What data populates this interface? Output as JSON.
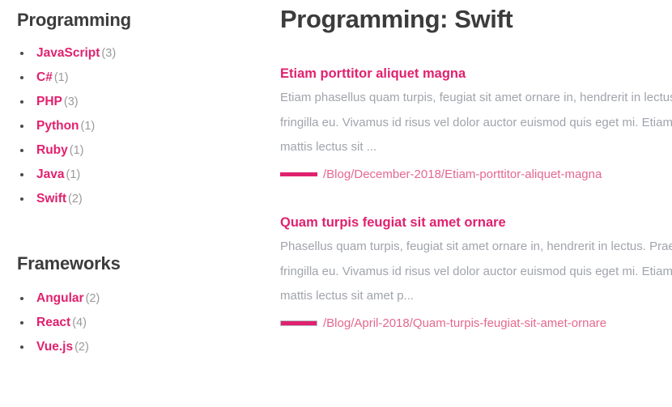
{
  "sidebar": {
    "sections": [
      {
        "heading": "Programming",
        "items": [
          {
            "label": "JavaScript",
            "count": "(3)"
          },
          {
            "label": "C#",
            "count": "(1)"
          },
          {
            "label": "PHP",
            "count": "(3)"
          },
          {
            "label": "Python",
            "count": "(1)"
          },
          {
            "label": "Ruby",
            "count": "(1)"
          },
          {
            "label": "Java",
            "count": "(1)"
          },
          {
            "label": "Swift",
            "count": "(2)"
          }
        ]
      },
      {
        "heading": "Frameworks",
        "items": [
          {
            "label": "Angular",
            "count": "(2)"
          },
          {
            "label": "React",
            "count": "(4)"
          },
          {
            "label": "Vue.js",
            "count": "(2)"
          }
        ]
      }
    ]
  },
  "main": {
    "page_title": "Programming: Swift",
    "posts": [
      {
        "title": "Etiam porttitor aliquet magna",
        "body_lines": [
          "Etiam phasellus quam turpis, feugiat sit amet ornare in, hendrerit in lectus. Praesent semper",
          "fringilla eu. Vivamus id risus vel dolor auctor euismod quis eget mi. Etiam eu ligula consectetur,",
          "mattis lectus sit ..."
        ],
        "url": "/Blog/December-2018/Etiam-porttitor-aliquet-magna"
      },
      {
        "title": "Quam turpis feugiat sit amet ornare",
        "body_lines": [
          "Phasellus quam turpis, feugiat sit amet ornare in, hendrerit in lectus. Praesent semper mollis",
          "fringilla eu. Vivamus id risus vel dolor auctor euismod quis eget mi. Etiam eu ligula consectetur,",
          "mattis lectus sit amet p..."
        ],
        "url": "/Blog/April-2018/Quam-turpis-feugiat-sit-amet-ornare"
      }
    ]
  },
  "colors": {
    "accent_pink": "#e0216f",
    "link_rose": "#e4688f",
    "heading_dark": "#3c3c3c",
    "body_gray": "#a0a4ab",
    "count_gray": "#9a9a9a"
  }
}
